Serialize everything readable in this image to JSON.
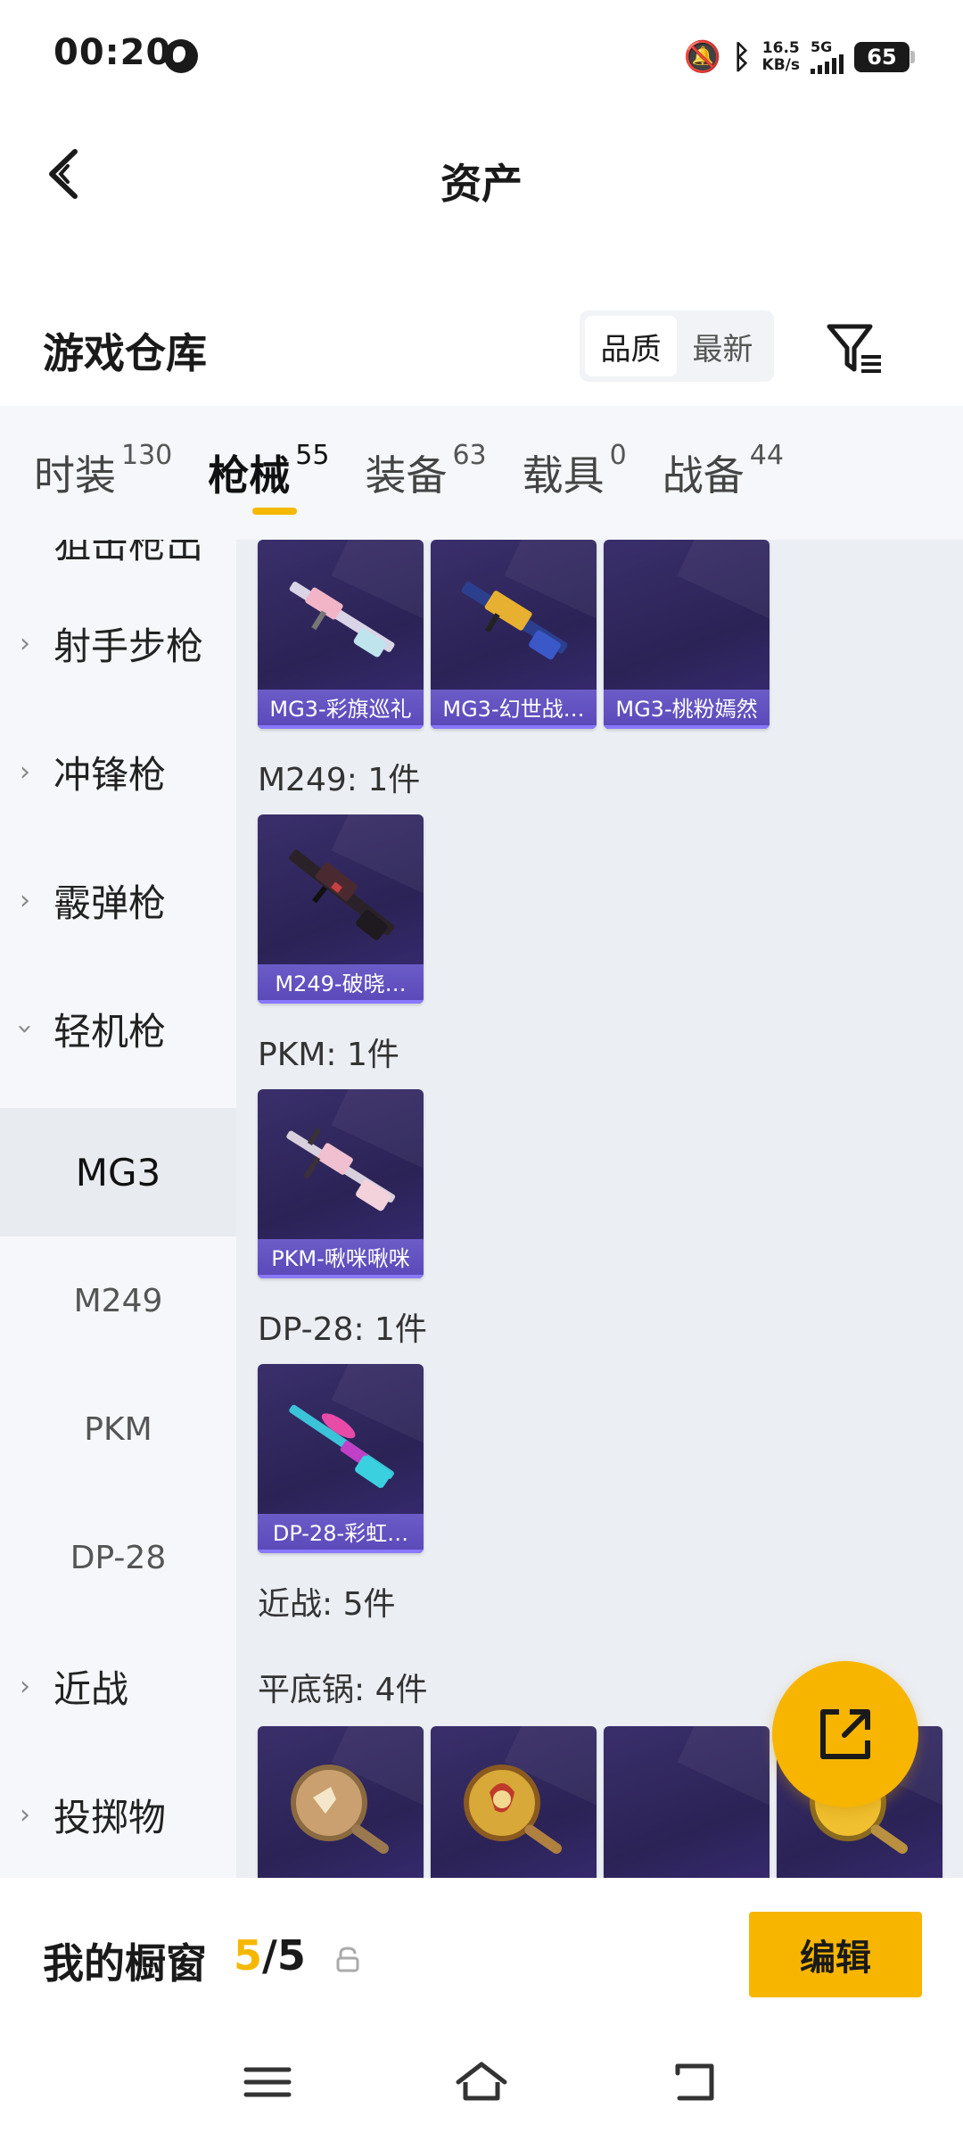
{
  "status_bar": {
    "time": "00:20",
    "speed_value": "16.5",
    "speed_unit": "KB/s",
    "network": "5G",
    "battery": "65"
  },
  "header": {
    "title": "资产"
  },
  "warehouse": {
    "title": "游戏仓库",
    "sort_quality": "品质",
    "sort_newest": "最新"
  },
  "tabs": [
    {
      "label": "时装",
      "count": "130"
    },
    {
      "label": "枪械",
      "count": "55"
    },
    {
      "label": "装备",
      "count": "63"
    },
    {
      "label": "载具",
      "count": "0"
    },
    {
      "label": "战备",
      "count": "44"
    }
  ],
  "sidebar": {
    "cut_item": "狙击枪出",
    "categories": [
      "射手步枪",
      "冲锋枪",
      "霰弹枪",
      "轻机枪"
    ],
    "subcategories": [
      "MG3",
      "M249",
      "PKM",
      "DP-28"
    ],
    "more_categories": [
      "近战",
      "投掷物"
    ]
  },
  "content": {
    "mg3_items": [
      "MG3-彩旗巡礼",
      "MG3-幻世战…",
      "MG3-桃粉嫣然"
    ],
    "m249_label": "M249: 1件",
    "m249_items": [
      "M249-破晓…"
    ],
    "pkm_label": "PKM: 1件",
    "pkm_items": [
      "PKM-啾咪啾咪"
    ],
    "dp28_label": "DP-28: 1件",
    "dp28_items": [
      "DP-28-彩虹…"
    ],
    "melee_label": "近战: 5件",
    "pan_label": "平底锅: 4件"
  },
  "showcase": {
    "label": "我的橱窗",
    "current": "5",
    "separator": "/",
    "total": "5",
    "edit_label": "编辑"
  },
  "icons": {
    "back": "back-arrow-icon",
    "filter": "filter-icon",
    "share": "share-export-icon",
    "lock": "lock-icon"
  },
  "colors": {
    "accent": "#f7b500",
    "card": "#2b2356",
    "card_label": "#5a48b8"
  }
}
